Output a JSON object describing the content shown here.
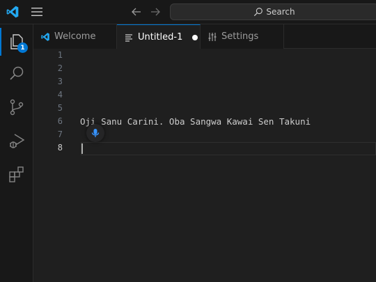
{
  "titlebar": {
    "search_placeholder": "Search"
  },
  "activity": {
    "explorer_badge": "1"
  },
  "tabs": [
    {
      "label": "Welcome"
    },
    {
      "label": "Untitled-1",
      "dirty": true
    },
    {
      "label": "Settings"
    }
  ],
  "editor": {
    "line_numbers": [
      "1",
      "2",
      "3",
      "4",
      "5",
      "6",
      "7",
      "8"
    ],
    "lines": [
      "",
      "",
      "",
      "",
      "",
      "Oji Sanu Carini. Oba Sangwa Kawai Sen Takuni",
      "",
      ""
    ],
    "current_line": 8
  },
  "colors": {
    "accent": "#0078d4",
    "editor_bg": "#1f1f1f",
    "chrome_bg": "#181818"
  }
}
